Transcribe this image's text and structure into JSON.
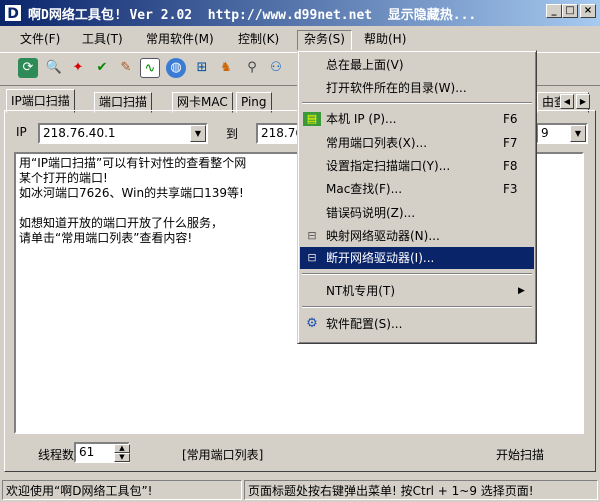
{
  "window": {
    "title": "啊D网络工具包! Ver 2.02  http://www.d99net.net  显示隐藏热...",
    "app_icon_letter": "D",
    "controls": {
      "minimize": "_",
      "maximize": "□",
      "close": "×"
    }
  },
  "menubar": {
    "items": [
      "文件(F)",
      "工具(T)",
      "常用软件(M)",
      "控制(K)",
      "杂务(S)",
      "帮助(H)"
    ],
    "active_index": 4
  },
  "toolbar": {
    "icons": [
      "refresh-icon",
      "search-icon",
      "colors-icon",
      "check-icon",
      "brush-icon",
      "chart-icon",
      "globe-icon",
      "network-icon",
      "person-icon",
      "scan-icon"
    ]
  },
  "tabs": {
    "items": [
      "IP端口扫描",
      "端口扫描",
      "网卡MAC",
      "Ping",
      "由查"
    ],
    "selected_index": 0
  },
  "scan": {
    "ip_label": "IP",
    "ip_from": "218.76.40.1",
    "to_label": "到",
    "ip_to": "218.76",
    "ip_to_tail": "9"
  },
  "textarea": {
    "text": "用“IP端口扫描”可以有针对性的查看整个网\n某个打开的端口!\n如冰河端口7626、Win的共享端口139等!\n\n如想知道开放的端口开放了什么服务，\n请单击“常用端口列表”查看内容!"
  },
  "bottom": {
    "threads_label": "线程数:",
    "threads_value": "61",
    "port_list_button": "[常用端口列表]",
    "start_button": "开始扫描"
  },
  "statusbar": {
    "cell1": "欢迎使用“啊D网络工具包”!",
    "cell2": "页面标题处按右键弹出菜单! 按Ctrl + 1~9  选择页面!"
  },
  "dropdown": {
    "items": [
      {
        "label": "总在最上面(V)",
        "key": "",
        "icon": ""
      },
      {
        "label": "打开软件所在的目录(W)...",
        "key": "",
        "icon": ""
      },
      {
        "label": "本机 IP (P)...",
        "key": "F6",
        "icon": "network-card-icon"
      },
      {
        "label": "常用端口列表(X)...",
        "key": "F7",
        "icon": ""
      },
      {
        "label": "设置指定扫描端口(Y)...",
        "key": "F8",
        "icon": ""
      },
      {
        "label": "Mac查找(F)...",
        "key": "F3",
        "icon": ""
      },
      {
        "label": "错误码说明(Z)...",
        "key": "",
        "icon": ""
      },
      {
        "label": "映射网络驱动器(N)...",
        "key": "",
        "icon": "map-drive-icon"
      },
      {
        "label": "断开网络驱动器(I)...",
        "key": "",
        "icon": "disconnect-drive-icon"
      },
      {
        "label": "NT机专用(T)",
        "key": "▶",
        "icon": ""
      },
      {
        "label": "软件配置(S)...",
        "key": "",
        "icon": "settings-icon"
      }
    ],
    "highlighted_index": 8
  }
}
